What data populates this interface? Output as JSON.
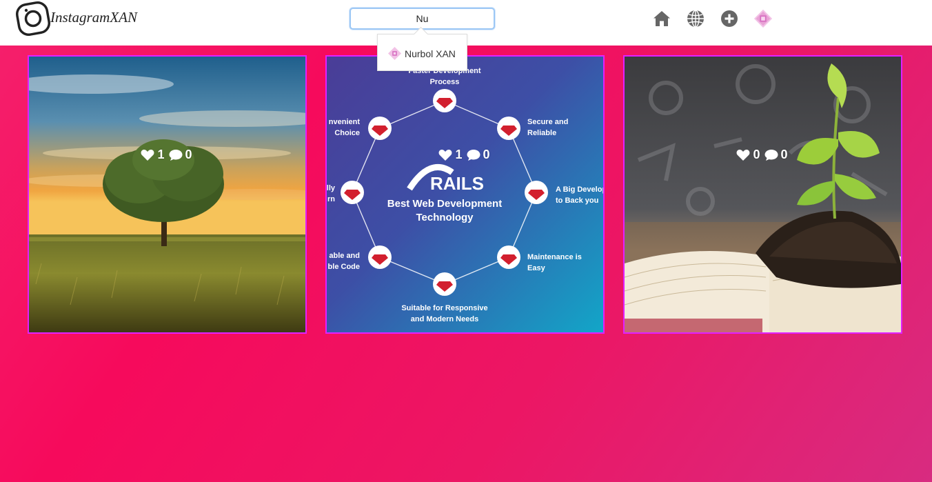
{
  "brand": {
    "name": "InstagramXAN",
    "logo_icon": "camera-icon"
  },
  "search": {
    "value": "Nu",
    "placeholder": ""
  },
  "search_results": [
    {
      "name": "Nurbol XAN",
      "icon": "pink-diamond-avatar-icon"
    }
  ],
  "nav": [
    {
      "name": "home-icon",
      "color": "#666666"
    },
    {
      "name": "globe-icon",
      "color": "#666666"
    },
    {
      "name": "plus-circle-icon",
      "color": "#666666"
    },
    {
      "name": "avatar",
      "color": "#e8a7d8"
    }
  ],
  "background": {
    "gradient_start": "#f51f6b",
    "gradient_end": "#d82b80",
    "card_border": "#e221ff"
  },
  "posts": [
    {
      "image": "tree-landscape",
      "likes": "1",
      "comments": "0"
    },
    {
      "image": "rails-infographic",
      "likes": "1",
      "comments": "0",
      "graphic": {
        "logo": "RAILS",
        "title_line1": "Best Web Development",
        "title_line2": "Technology",
        "labels": [
          "Faster Development",
          "Process",
          "Secure and",
          "Reliable",
          "A Big Develop",
          "to Back you",
          "Maintenance is",
          "Easy",
          "Suitable for Responsive",
          "and Modern Needs",
          "able and",
          "ble Code",
          "lly",
          "rn",
          "nvenient",
          "Choice"
        ]
      }
    },
    {
      "image": "plant-in-book",
      "likes": "0",
      "comments": "0"
    }
  ]
}
